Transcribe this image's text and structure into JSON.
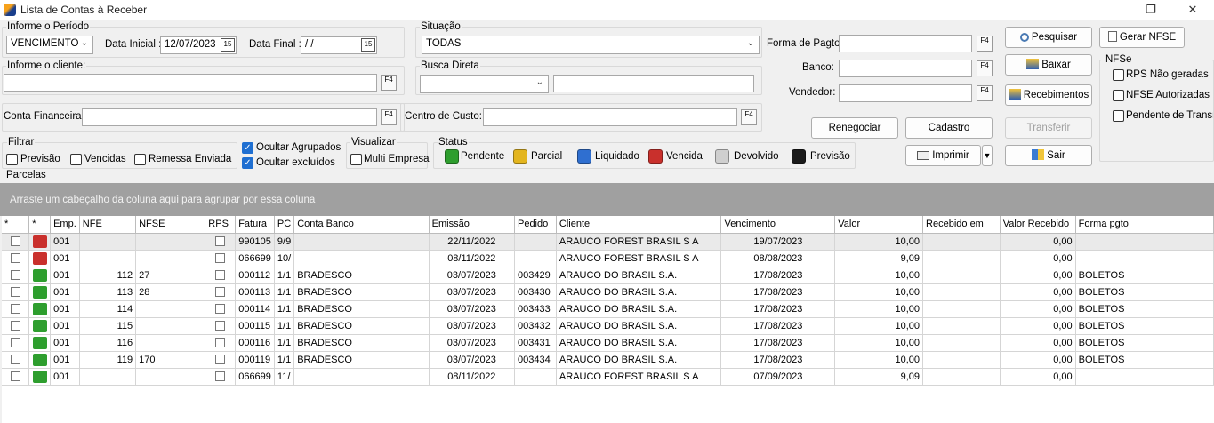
{
  "window": {
    "title": "Lista de Contas à Receber",
    "restore_glyph": "❐",
    "close_glyph": "✕"
  },
  "periodo": {
    "group_label": "Informe o Período",
    "tipo_value": "VENCIMENTO",
    "data_inicial_label": "Data Inicial :",
    "data_inicial_value": "12/07/2023",
    "data_final_label": "Data Final :",
    "data_final_value": " /  /",
    "cal_glyph": "15"
  },
  "cliente": {
    "group_label": "Informe o cliente:",
    "value": ""
  },
  "situacao": {
    "group_label": "Situação",
    "value": "TODAS"
  },
  "busca_direta": {
    "group_label": "Busca Direta",
    "combo_value": "",
    "text_value": ""
  },
  "conta_financeira": {
    "label": "Conta Financeira:",
    "value": ""
  },
  "centro_custo": {
    "label": "Centro de Custo:",
    "value": ""
  },
  "forma_pagto": {
    "label": "Forma de Pagto:",
    "value": ""
  },
  "banco": {
    "label": "Banco:",
    "value": ""
  },
  "vendedor": {
    "label": "Vendedor:",
    "value": ""
  },
  "f4_glyph": "F4",
  "buttons": {
    "pesquisar": "Pesquisar",
    "gerar_nfse": "Gerar NFSE",
    "baixar": "Baixar",
    "recebimentos": "Recebimentos",
    "renegociar": "Renegociar",
    "cadastro": "Cadastro",
    "transferir": "Transferir",
    "imprimir": "Imprimir",
    "sair": "Sair"
  },
  "nfse": {
    "group_label": "NFSe",
    "options": [
      "RPS Não geradas",
      "NFSE Autorizadas",
      "Pendente de Transm"
    ]
  },
  "filtrar": {
    "group_label": "Filtrar",
    "options": [
      "Previsão",
      "Vencidas",
      "Remessa Enviada"
    ]
  },
  "ocultar": {
    "agrupados": "Ocultar Agrupados",
    "excluidos": "Ocultar excluídos",
    "check_glyph": "✓"
  },
  "visualizar": {
    "group_label": "Visualizar",
    "multi_empresa": "Multi Empresa"
  },
  "status": {
    "group_label": "Status",
    "items": [
      {
        "label": "Pendente",
        "color": "#2e9e2e"
      },
      {
        "label": "Parcial",
        "color": "#e3b51e"
      },
      {
        "label": "Liquidado",
        "color": "#2f6fd0"
      },
      {
        "label": "Vencida",
        "color": "#c9302c"
      },
      {
        "label": "Devolvido",
        "color": "#cfcfcf"
      },
      {
        "label": "Previsão",
        "color": "#1a1a1a"
      }
    ]
  },
  "parcelas": {
    "section_label": "Parcelas",
    "group_hint": "Arraste um cabeçalho da coluna aqui para agrupar por essa coluna",
    "columns": [
      "*",
      "*",
      "Emp.",
      "NFE",
      "NFSE",
      "RPS",
      "Fatura",
      "PC",
      "Conta Banco",
      "Emissão",
      "Pedido",
      "Cliente",
      "Vencimento",
      "Valor",
      "Recebido em",
      "Valor Recebido",
      "Forma pgto"
    ],
    "rows": [
      {
        "status_color": "#c9302c",
        "emp": "001",
        "nfe": "",
        "nfse": "",
        "fatura": "990105",
        "pc": "9/9",
        "conta": "",
        "emissao": "22/11/2022",
        "pedido": "",
        "cliente": "ARAUCO FOREST BRASIL S A",
        "vencimento": "19/07/2023",
        "valor": "10,00",
        "recebido_em": "",
        "valor_recebido": "0,00",
        "forma": ""
      },
      {
        "status_color": "#c9302c",
        "emp": "001",
        "nfe": "",
        "nfse": "",
        "fatura": "066699",
        "pc": "10/",
        "conta": "",
        "emissao": "08/11/2022",
        "pedido": "",
        "cliente": "ARAUCO FOREST BRASIL S A",
        "vencimento": "08/08/2023",
        "valor": "9,09",
        "recebido_em": "",
        "valor_recebido": "0,00",
        "forma": ""
      },
      {
        "status_color": "#2e9e2e",
        "emp": "001",
        "nfe": "112",
        "nfse": "27",
        "fatura": "000112",
        "pc": "1/1",
        "conta": "BRADESCO",
        "emissao": "03/07/2023",
        "pedido": "003429",
        "cliente": "ARAUCO DO BRASIL S.A.",
        "vencimento": "17/08/2023",
        "valor": "10,00",
        "recebido_em": "",
        "valor_recebido": "0,00",
        "forma": "BOLETOS"
      },
      {
        "status_color": "#2e9e2e",
        "emp": "001",
        "nfe": "113",
        "nfse": "28",
        "fatura": "000113",
        "pc": "1/1",
        "conta": "BRADESCO",
        "emissao": "03/07/2023",
        "pedido": "003430",
        "cliente": "ARAUCO DO BRASIL S.A.",
        "vencimento": "17/08/2023",
        "valor": "10,00",
        "recebido_em": "",
        "valor_recebido": "0,00",
        "forma": "BOLETOS"
      },
      {
        "status_color": "#2e9e2e",
        "emp": "001",
        "nfe": "114",
        "nfse": "",
        "fatura": "000114",
        "pc": "1/1",
        "conta": "BRADESCO",
        "emissao": "03/07/2023",
        "pedido": "003433",
        "cliente": "ARAUCO DO BRASIL S.A.",
        "vencimento": "17/08/2023",
        "valor": "10,00",
        "recebido_em": "",
        "valor_recebido": "0,00",
        "forma": "BOLETOS"
      },
      {
        "status_color": "#2e9e2e",
        "emp": "001",
        "nfe": "115",
        "nfse": "",
        "fatura": "000115",
        "pc": "1/1",
        "conta": "BRADESCO",
        "emissao": "03/07/2023",
        "pedido": "003432",
        "cliente": "ARAUCO DO BRASIL S.A.",
        "vencimento": "17/08/2023",
        "valor": "10,00",
        "recebido_em": "",
        "valor_recebido": "0,00",
        "forma": "BOLETOS"
      },
      {
        "status_color": "#2e9e2e",
        "emp": "001",
        "nfe": "116",
        "nfse": "",
        "fatura": "000116",
        "pc": "1/1",
        "conta": "BRADESCO",
        "emissao": "03/07/2023",
        "pedido": "003431",
        "cliente": "ARAUCO DO BRASIL S.A.",
        "vencimento": "17/08/2023",
        "valor": "10,00",
        "recebido_em": "",
        "valor_recebido": "0,00",
        "forma": "BOLETOS"
      },
      {
        "status_color": "#2e9e2e",
        "emp": "001",
        "nfe": "119",
        "nfse": "170",
        "fatura": "000119",
        "pc": "1/1",
        "conta": "BRADESCO",
        "emissao": "03/07/2023",
        "pedido": "003434",
        "cliente": "ARAUCO DO BRASIL S.A.",
        "vencimento": "17/08/2023",
        "valor": "10,00",
        "recebido_em": "",
        "valor_recebido": "0,00",
        "forma": "BOLETOS"
      },
      {
        "status_color": "#2e9e2e",
        "emp": "001",
        "nfe": "",
        "nfse": "",
        "fatura": "066699",
        "pc": "11/",
        "conta": "",
        "emissao": "08/11/2022",
        "pedido": "",
        "cliente": "ARAUCO FOREST BRASIL S A",
        "vencimento": "07/09/2023",
        "valor": "9,09",
        "recebido_em": "",
        "valor_recebido": "0,00",
        "forma": ""
      }
    ]
  }
}
